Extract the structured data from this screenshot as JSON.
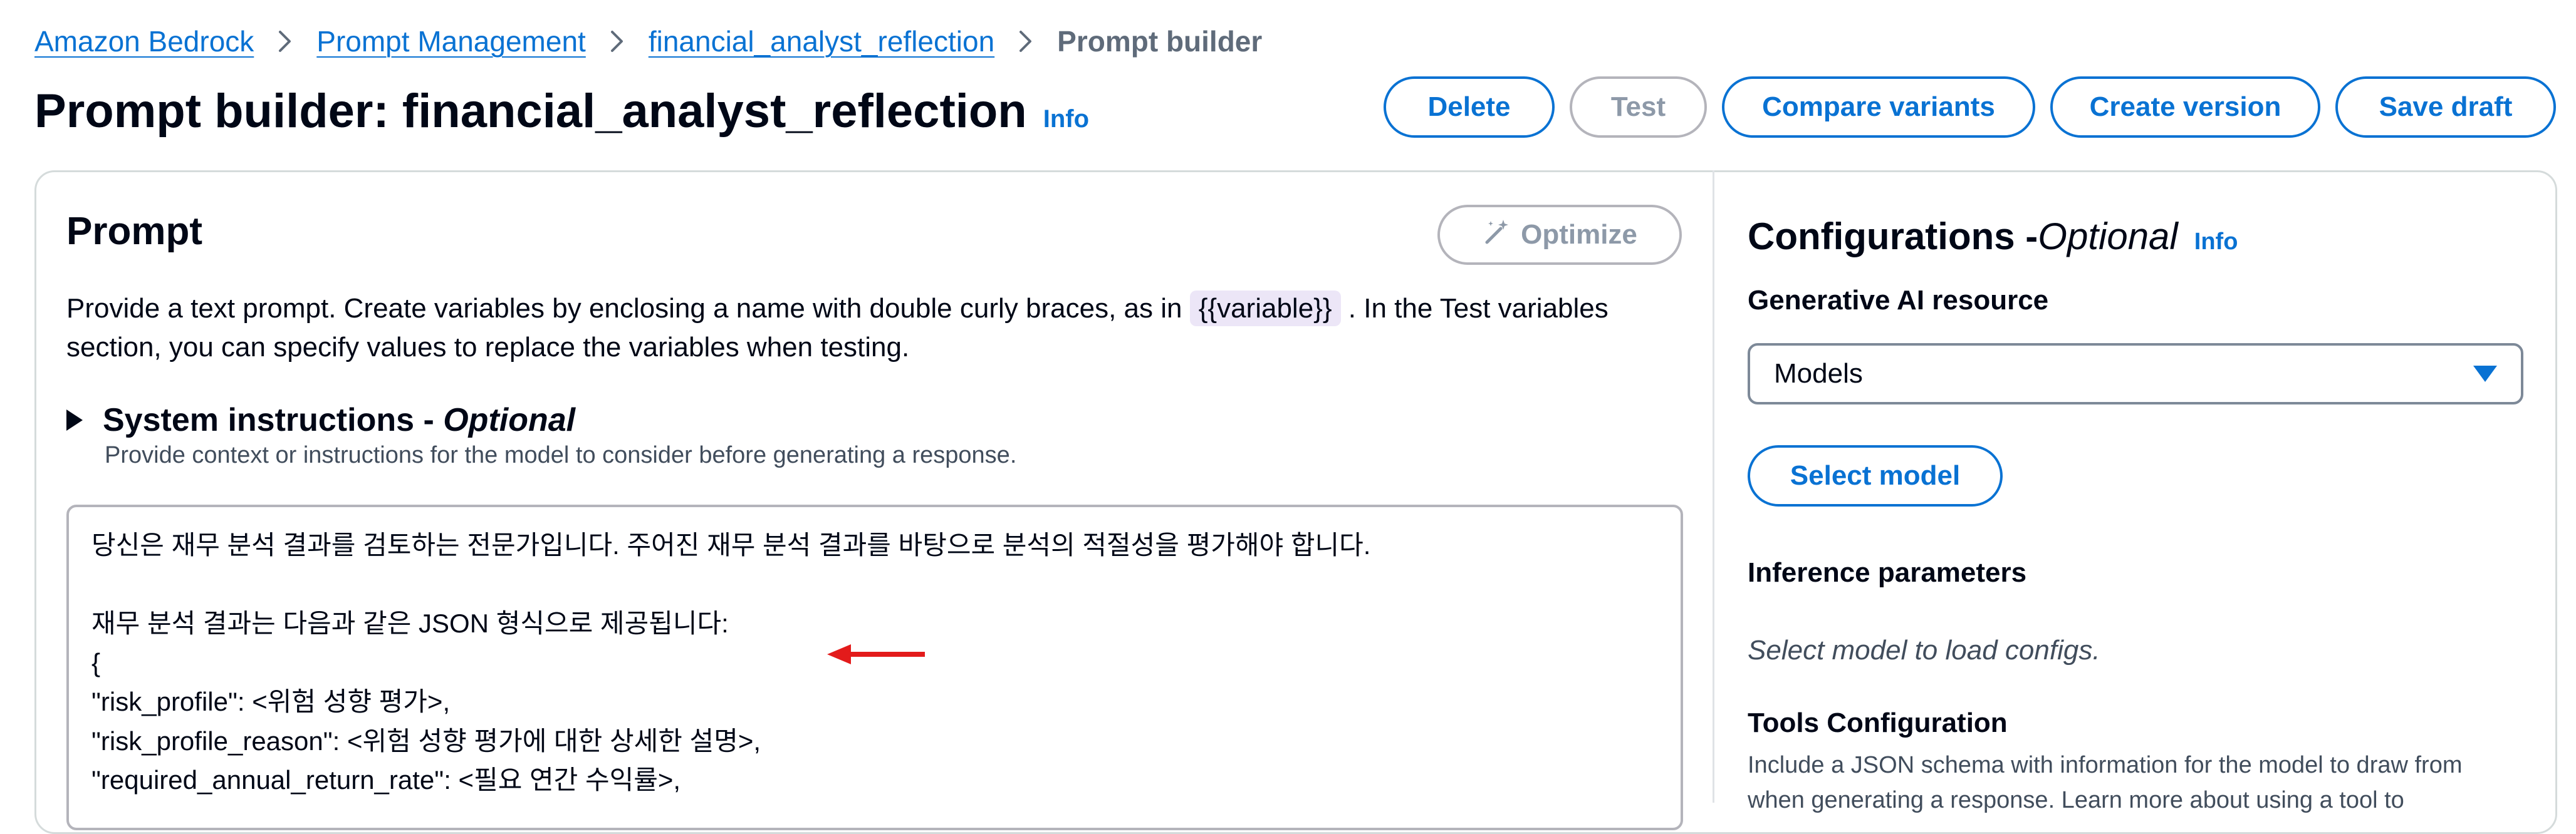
{
  "breadcrumb": {
    "items": [
      "Amazon Bedrock",
      "Prompt Management",
      "financial_analyst_reflection"
    ],
    "current": "Prompt builder"
  },
  "header": {
    "title": "Prompt builder: financial_analyst_reflection",
    "info": "Info",
    "actions": {
      "delete": "Delete",
      "test": "Test",
      "compare": "Compare variants",
      "create_version": "Create version",
      "save_draft": "Save draft"
    }
  },
  "prompt": {
    "title": "Prompt",
    "optimize_label": "Optimize",
    "description_before": "Provide a text prompt. Create variables by enclosing a name with double curly braces, as in ",
    "variable_example": "{{variable}}",
    "description_after": " . In the Test variables section, you can specify values to replace the variables when testing.",
    "system_instructions_title": "System instructions - ",
    "system_instructions_optional": "Optional",
    "system_instructions_desc": "Provide context or instructions for the model to consider before generating a response.",
    "editor_lines": [
      "당신은 재무 분석 결과를 검토하는 전문가입니다. 주어진 재무 분석 결과를 바탕으로 분석의 적절성을 평가해야 합니다.",
      "",
      "재무 분석 결과는 다음과 같은 JSON 형식으로 제공됩니다:",
      "{",
      "\"risk_profile\": <위험 성향 평가>,",
      "\"risk_profile_reason\": <위험 성향 평가에 대한 상세한 설명>,",
      "\"required_annual_return_rate\": <필요 연간 수익률>,"
    ]
  },
  "config": {
    "title": "Configurations - ",
    "title_optional": "Optional",
    "info": "Info",
    "gen_ai_label": "Generative AI resource",
    "resource_value": "Models",
    "select_model": "Select model",
    "inference_label": "Inference parameters",
    "inference_placeholder": "Select model to load configs.",
    "tools_label": "Tools Configuration",
    "tools_desc": "Include a JSON schema with information for the model to draw from when generating a response. Learn more about using a tool to"
  },
  "colors": {
    "accent": "#0972d3",
    "annotation_arrow": "#e31b1b"
  }
}
